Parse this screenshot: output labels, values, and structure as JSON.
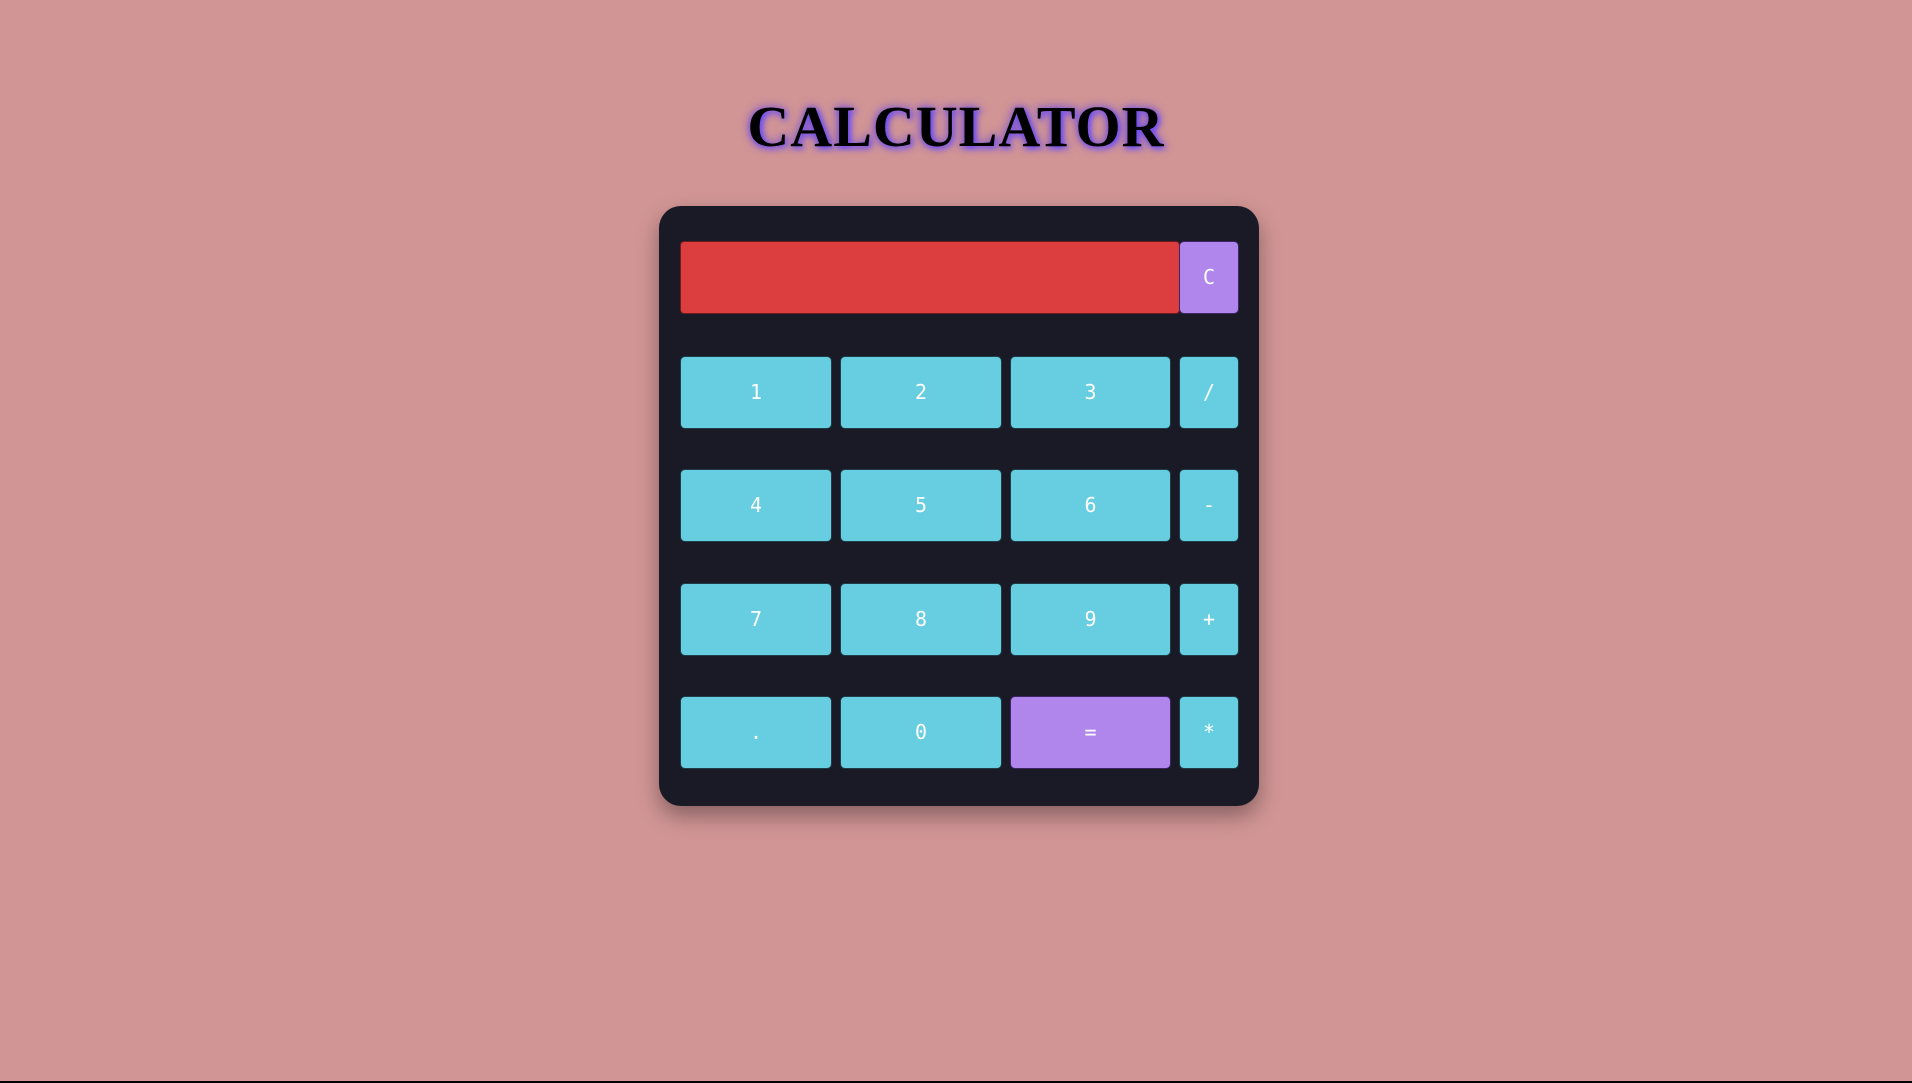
{
  "page": {
    "title": "CALCULATOR"
  },
  "display": {
    "value": ""
  },
  "keys": {
    "clear": "C",
    "one": "1",
    "two": "2",
    "three": "3",
    "divide": "/",
    "four": "4",
    "five": "5",
    "six": "6",
    "minus": "-",
    "seven": "7",
    "eight": "8",
    "nine": "9",
    "plus": "+",
    "dot": ".",
    "zero": "0",
    "equals": "=",
    "multiply": "*"
  },
  "colors": {
    "background": "#d19595",
    "body": "#191a26",
    "display": "#dc3d3e",
    "key": "#67cde0",
    "accent_key": "#b085ec"
  }
}
